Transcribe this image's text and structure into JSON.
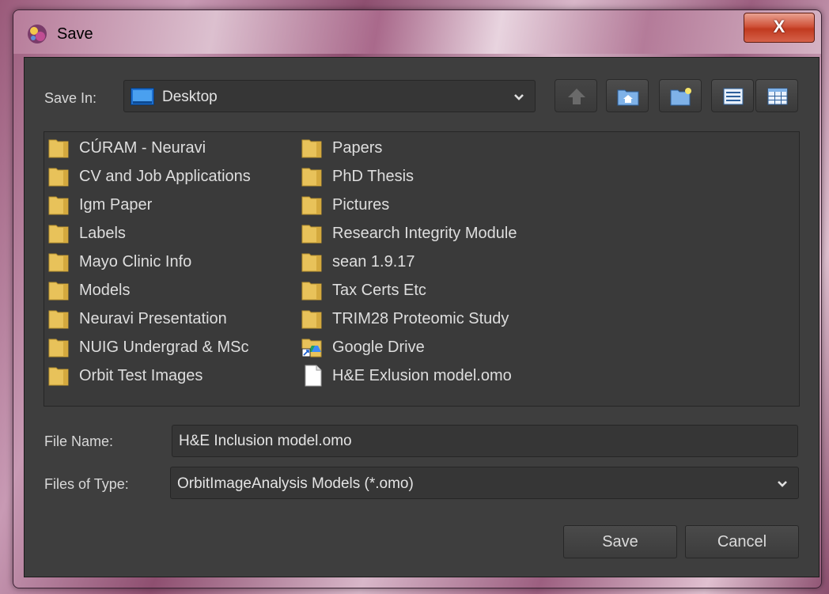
{
  "window": {
    "title": "Save",
    "close_glyph": "X"
  },
  "save_in": {
    "label": "Save In:",
    "value": "Desktop",
    "icon": "desktop-icon"
  },
  "toolbar": {
    "buttons": [
      "up-one-level-icon",
      "home-icon",
      "new-folder-icon",
      "list-view-icon",
      "details-view-icon"
    ]
  },
  "files": {
    "column1": [
      {
        "name": "CÚRAM - Neuravi",
        "icon": "folder-icon"
      },
      {
        "name": "CV and Job Applications",
        "icon": "folder-icon"
      },
      {
        "name": "Igm Paper",
        "icon": "folder-icon"
      },
      {
        "name": "Labels",
        "icon": "folder-icon"
      },
      {
        "name": "Mayo Clinic Info",
        "icon": "folder-icon"
      },
      {
        "name": "Models",
        "icon": "folder-icon"
      },
      {
        "name": "Neuravi Presentation",
        "icon": "folder-icon"
      },
      {
        "name": "NUIG Undergrad & MSc",
        "icon": "folder-icon"
      },
      {
        "name": "Orbit Test Images",
        "icon": "folder-icon"
      }
    ],
    "column2": [
      {
        "name": "Papers",
        "icon": "folder-icon"
      },
      {
        "name": "PhD Thesis",
        "icon": "folder-icon"
      },
      {
        "name": "Pictures",
        "icon": "folder-icon"
      },
      {
        "name": "Research Integrity Module",
        "icon": "folder-icon"
      },
      {
        "name": "sean 1.9.17",
        "icon": "folder-icon"
      },
      {
        "name": "Tax Certs Etc",
        "icon": "folder-icon"
      },
      {
        "name": "TRIM28 Proteomic Study",
        "icon": "folder-icon"
      },
      {
        "name": "Google Drive",
        "icon": "shortcut-folder-icon"
      },
      {
        "name": "H&E Exlusion model.omo",
        "icon": "file-icon"
      }
    ]
  },
  "file_name": {
    "label": "File Name:",
    "value": "H&E Inclusion model.omo"
  },
  "file_type": {
    "label": "Files of Type:",
    "value": "OrbitImageAnalysis Models (*.omo)"
  },
  "actions": {
    "save_label": "Save",
    "cancel_label": "Cancel"
  },
  "colors": {
    "dialog_bg": "#3e3e3e",
    "folder": "#e8c25a",
    "close_button": "#c13a20"
  }
}
